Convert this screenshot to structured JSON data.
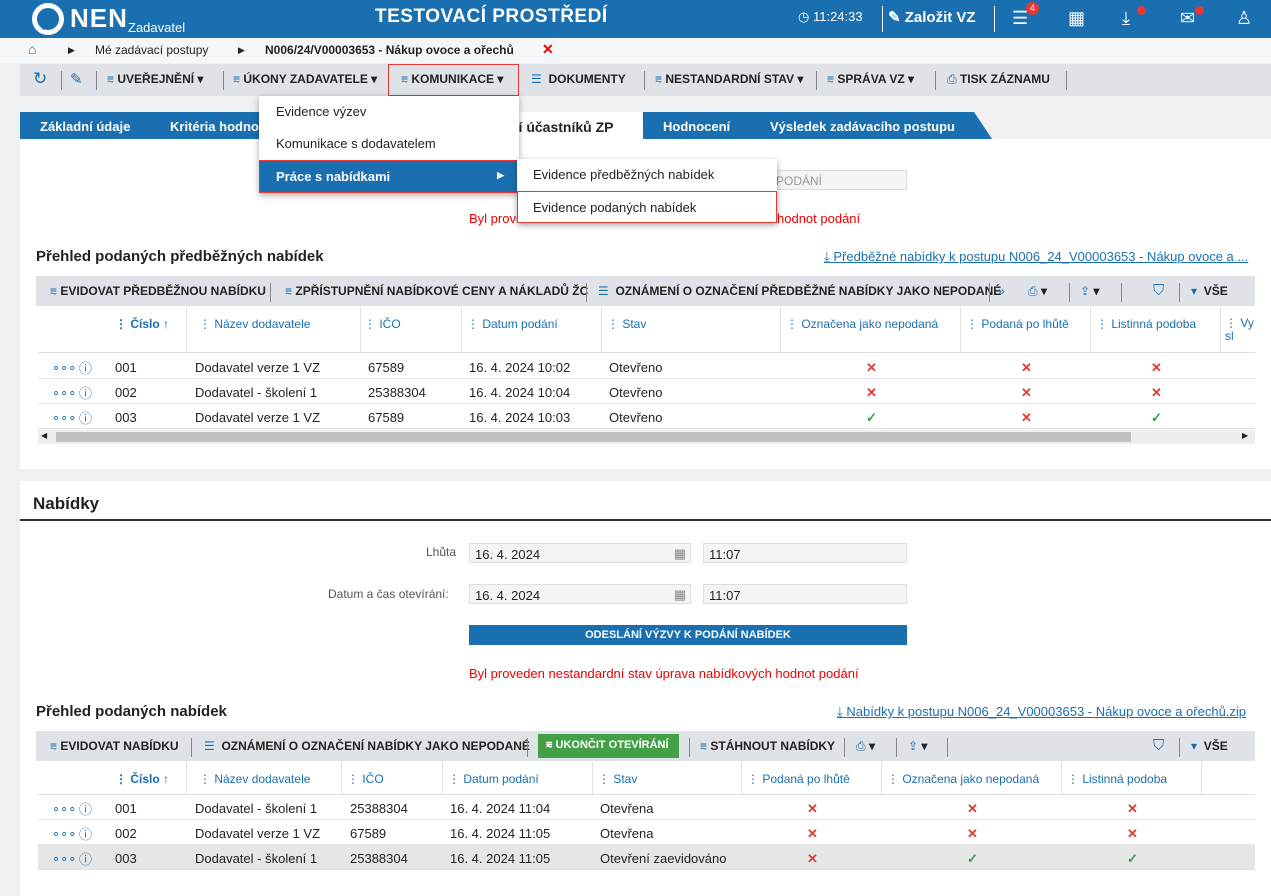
{
  "header": {
    "logo": "NEN",
    "subtitle": "Zadavatel",
    "env": "TESTOVACÍ PROSTŘEDÍ",
    "time": "11:24:33",
    "create": "Založit VZ",
    "menu_badge": "4",
    "icons": [
      "clock-icon",
      "edit-icon",
      "menu-icon",
      "calendar-icon",
      "inbox-icon",
      "mail-icon",
      "user-icon"
    ]
  },
  "breadcrumb": {
    "item1": "Mé zadávací postupy",
    "item2": "N006/24/V00003653 - Nákup ovoce a ořechů"
  },
  "toolbar": {
    "publish": "UVEŘEJNĚNÍ",
    "acts": "ÚKONY ZADAVATELE",
    "comm": "KOMUNIKACE",
    "docs": "DOKUMENTY",
    "nonstd": "NESTANDARDNÍ STAV",
    "admin": "SPRÁVA VZ",
    "print": "TISK ZÁZNAMU"
  },
  "tabs": {
    "t1": "Základní údaje",
    "t2": "Kritéria hodno",
    "t3": "ní účastníků ZP",
    "t4": "Hodnocení",
    "t5": "Výsledek zadávacího postupu"
  },
  "menu": {
    "m1": "Evidence výzev",
    "m2": "Komunikace s dodavatelem",
    "m3": "Práce s nabídkami",
    "s1": "Evidence předběžných nabídek",
    "s2": "Evidence podaných nabídek"
  },
  "top": {
    "partial": "PODÁNÍ",
    "red": "Byl proveden nestandardní stav úprava nabídkových hodnot podání",
    "red_visible": "Byl proved",
    "red_visible2": "hodnot podání"
  },
  "prelim": {
    "title": "Přehled podaných předběžných nabídek",
    "link": "Předběžné nabídky k postupu N006_24_V00003653 - Nákup ovoce a ...",
    "tb": {
      "a": "EVIDOVAT PŘEDBĚŽNOU NABÍDKU",
      "b": "ZPŘÍSTUPNĚNÍ NABÍDKOVÉ CENY A NÁKLADŮ ŽC",
      "c": "OZNÁMENÍ O OZNAČENÍ PŘEDBĚŽNÉ NABÍDKY JAKO NEPODANÉ",
      "all": "VŠE"
    },
    "cols": {
      "c1": "Číslo",
      "c2": "Název dodavatele",
      "c3": "IČO",
      "c4": "Datum podání",
      "c5": "Stav",
      "c6": "Označena jako nepodaná",
      "c7": "Podaná po lhůtě",
      "c8": "Listinná podoba",
      "c9": "Vy sl"
    },
    "rows": [
      {
        "no": "001",
        "name": "Dodavatel verze 1 VZ",
        "ico": "67589",
        "date": "16. 4. 2024 10:02",
        "state": "Otevřeno",
        "a": "✕",
        "b": "✕",
        "c": "✕"
      },
      {
        "no": "002",
        "name": "Dodavatel - školení 1",
        "ico": "25388304",
        "date": "16. 4. 2024 10:04",
        "state": "Otevřeno",
        "a": "✕",
        "b": "✕",
        "c": "✕"
      },
      {
        "no": "003",
        "name": "Dodavatel verze 1 VZ",
        "ico": "67589",
        "date": "16. 4. 2024 10:03",
        "state": "Otevřeno",
        "a": "✓",
        "b": "✕",
        "c": "✓"
      }
    ]
  },
  "offers": {
    "section": "Nabídky",
    "deadline_label": "Lhůta",
    "deadline_date": "16. 4. 2024",
    "deadline_time": "11:07",
    "open_label": "Datum a čas otevírání:",
    "open_date": "16. 4. 2024",
    "open_time": "11:07",
    "send_btn": "ODESLÁNÍ VÝZVY K PODÁNÍ NABÍDEK",
    "red": "Byl proveden nestandardní stav úprava nabídkových hodnot podání",
    "title": "Přehled podaných nabídek",
    "link": "Nabídky k postupu N006_24_V00003653 - Nákup ovoce a ořechů.zip",
    "tb": {
      "a": "EVIDOVAT NABÍDKU",
      "b": "OZNÁMENÍ O OZNAČENÍ NABÍDKY JAKO NEPODANÉ",
      "c": "UKONČIT OTEVÍRÁNÍ",
      "d": "STÁHNOUT NABÍDKY",
      "all": "VŠE"
    },
    "cols": {
      "c1": "Číslo",
      "c2": "Název dodavatele",
      "c3": "IČO",
      "c4": "Datum podání",
      "c5": "Stav",
      "c6": "Podaná po lhůtě",
      "c7": "Označena jako nepodaná",
      "c8": "Listinná podoba"
    },
    "rows": [
      {
        "no": "001",
        "name": "Dodavatel - školení 1",
        "ico": "25388304",
        "date": "16. 4. 2024 11:04",
        "state": "Otevřena",
        "a": "✕",
        "b": "✕",
        "c": "✕"
      },
      {
        "no": "002",
        "name": "Dodavatel verze 1 VZ",
        "ico": "67589",
        "date": "16. 4. 2024 11:05",
        "state": "Otevřena",
        "a": "✕",
        "b": "✕",
        "c": "✕"
      },
      {
        "no": "003",
        "name": "Dodavatel - školení 1",
        "ico": "25388304",
        "date": "16. 4. 2024 11:05",
        "state": "Otevření zaevidováno",
        "a": "✕",
        "b": "✓",
        "c": "✓"
      }
    ]
  }
}
